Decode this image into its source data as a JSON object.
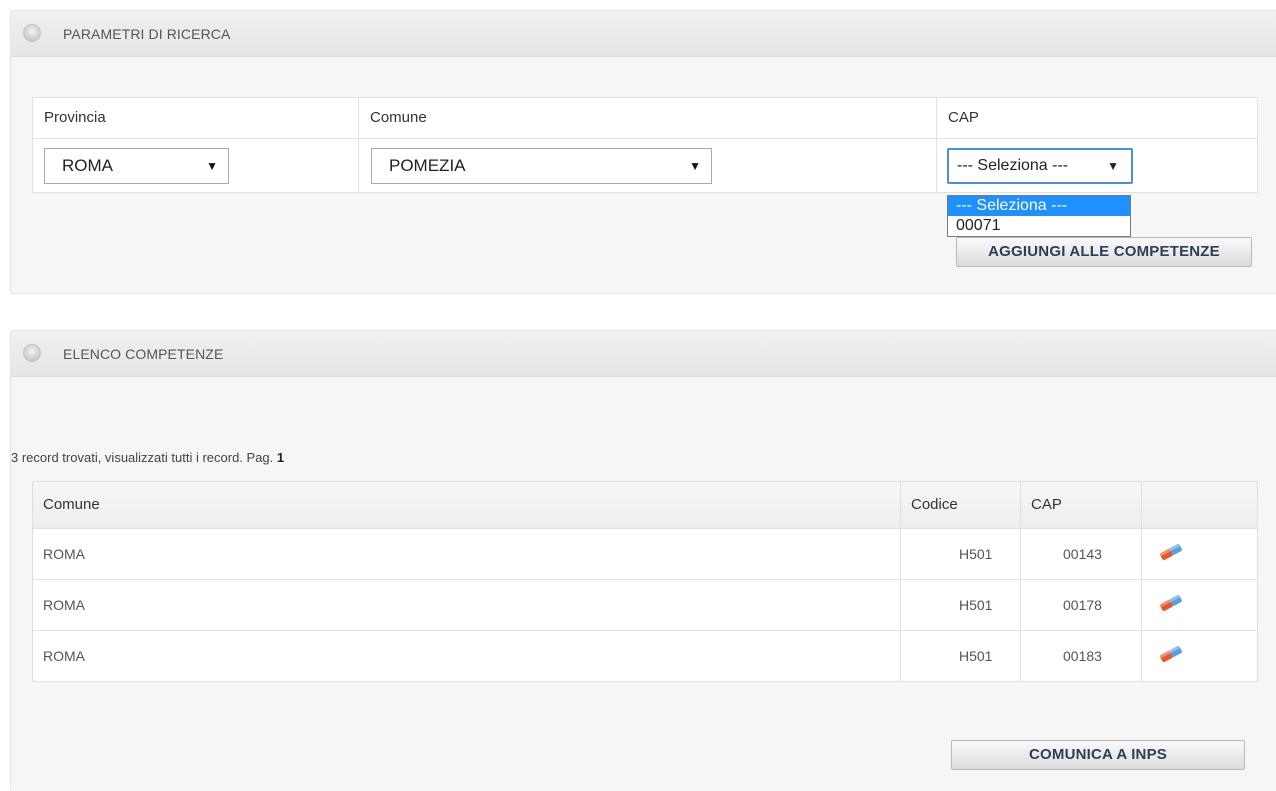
{
  "search_panel": {
    "title": "PARAMETRI DI RICERCA",
    "columns": {
      "provincia": "Provincia",
      "comune": "Comune",
      "cap": "CAP"
    },
    "provincia_value": "ROMA",
    "comune_value": "POMEZIA",
    "cap_value": "--- Seleziona ---",
    "cap_options": [
      "--- Seleziona ---",
      "00071"
    ],
    "cap_selected_index": 0,
    "add_button": "AGGIUNGI ALLE COMPETENZE"
  },
  "list_panel": {
    "title": "ELENCO COMPETENZE",
    "record_info": "3 record trovati, visualizzati tutti i record. Pag.",
    "page": "1",
    "headers": [
      "Comune",
      "Codice",
      "CAP",
      ""
    ],
    "rows": [
      {
        "comune": "ROMA",
        "codice": "H501",
        "cap": "00143",
        "icon": "eraser-icon"
      },
      {
        "comune": "ROMA",
        "codice": "H501",
        "cap": "00178",
        "icon": "eraser-icon"
      },
      {
        "comune": "ROMA",
        "codice": "H501",
        "cap": "00183",
        "icon": "eraser-icon"
      }
    ],
    "send_button": "COMUNICA A INPS"
  },
  "colors": {
    "accent": "#1e90ff",
    "focus_border": "#4a90d9",
    "button_text": "#2c3f58",
    "eraser_orange": "#e8562a",
    "eraser_blue": "#5aa0dc"
  }
}
